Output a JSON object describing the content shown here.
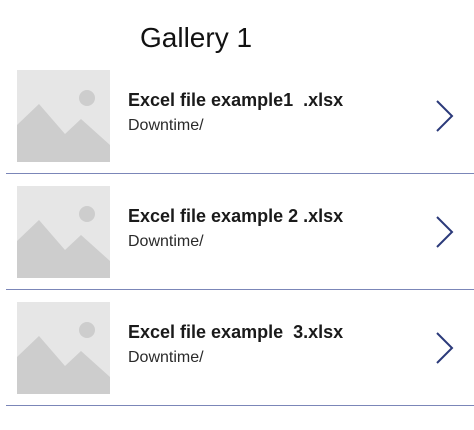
{
  "gallery": {
    "title": "Gallery 1",
    "items": [
      {
        "title": "Excel file example1  .xlsx",
        "subtitle": "Downtime/",
        "thumbnail_icon": "image-placeholder-icon",
        "nav_icon": "chevron-right-icon"
      },
      {
        "title": "Excel file example 2 .xlsx",
        "subtitle": "Downtime/",
        "thumbnail_icon": "image-placeholder-icon",
        "nav_icon": "chevron-right-icon"
      },
      {
        "title": "Excel file example  3.xlsx",
        "subtitle": "Downtime/",
        "thumbnail_icon": "image-placeholder-icon",
        "nav_icon": "chevron-right-icon"
      }
    ]
  },
  "colors": {
    "separator": "#7b86b8",
    "chevron": "#2b3a7a",
    "thumbnail_bg": "#e6e6e6",
    "thumbnail_shape": "#cdcdcd"
  }
}
